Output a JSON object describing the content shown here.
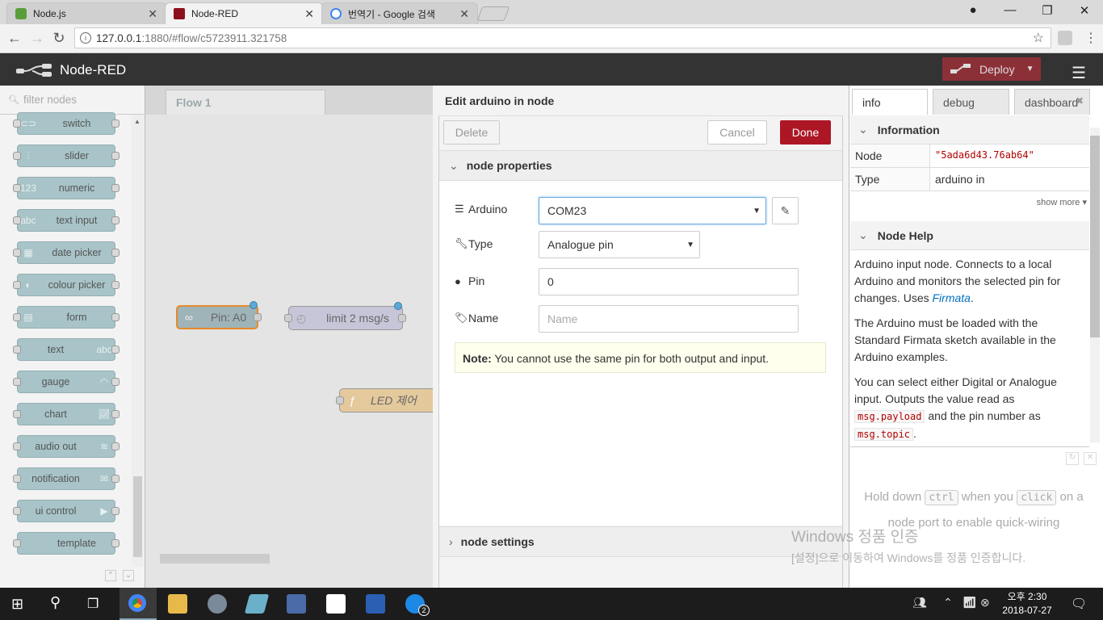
{
  "browser": {
    "tabs": [
      {
        "label": "Node.js",
        "active": false
      },
      {
        "label": "Node-RED",
        "active": true
      },
      {
        "label": "번역기 - Google 검색",
        "active": false
      }
    ],
    "url_host": "127.0.0.1",
    "url_rest": ":1880/#flow/c5723911.321758"
  },
  "header": {
    "title": "Node-RED",
    "deploy_label": "Deploy"
  },
  "palette": {
    "filter_placeholder": "filter nodes",
    "nodes": [
      "switch",
      "slider",
      "numeric",
      "text input",
      "date picker",
      "colour picker",
      "form",
      "text",
      "gauge",
      "chart",
      "audio out",
      "notification",
      "ui control",
      "template"
    ]
  },
  "workspace": {
    "tab_label": "Flow 1",
    "nodes": {
      "pin": "Pin: A0",
      "limit": "limit 2 msg/s",
      "led": "LED 제어"
    }
  },
  "editor": {
    "title": "Edit arduino in node",
    "delete_label": "Delete",
    "cancel_label": "Cancel",
    "done_label": "Done",
    "section_properties": "node properties",
    "section_settings": "node settings",
    "arduino_label": "Arduino",
    "arduino_value": "COM23",
    "type_label": "Type",
    "type_value": "Analogue pin",
    "pin_label": "Pin",
    "pin_value": "0",
    "name_label": "Name",
    "name_placeholder": "Name",
    "note_bold": "Note:",
    "note_text": " You cannot use the same pin for both output and input."
  },
  "sidebar": {
    "tabs": [
      "info",
      "debug",
      "dashboard"
    ],
    "info_header": "Information",
    "rows": [
      {
        "k": "Node",
        "v": "\"5ada6d43.76ab64\""
      },
      {
        "k": "Type",
        "v": "arduino in"
      }
    ],
    "show_more": "show more ▾",
    "help_header": "Node Help",
    "help_p1a": "Arduino input node. Connects to a local Arduino and monitors the selected pin for changes. Uses ",
    "help_p1_link": "Firmata",
    "help_p1b": ".",
    "help_p2": "The Arduino must be loaded with the Standard Firmata sketch available in the Arduino examples.",
    "help_p3a": "You can select either Digital or Analogue input. Outputs the value read as ",
    "help_code1": "msg.payload",
    "help_p3b": " and the pin number as ",
    "help_code2": "msg.topic",
    "help_p3c": ".",
    "hint_a": "Hold down ",
    "hint_k1": "ctrl",
    "hint_b": " when you ",
    "hint_k2": "click",
    "hint_c": " on a node port to enable quick-wiring"
  },
  "watermark": {
    "line1": "Windows 정품 인증",
    "line2": "[설정]으로 이동하여 Windows를 정품 인증합니다."
  },
  "taskbar": {
    "time": "오후 2:30",
    "date": "2018-07-27",
    "badge": "2"
  }
}
